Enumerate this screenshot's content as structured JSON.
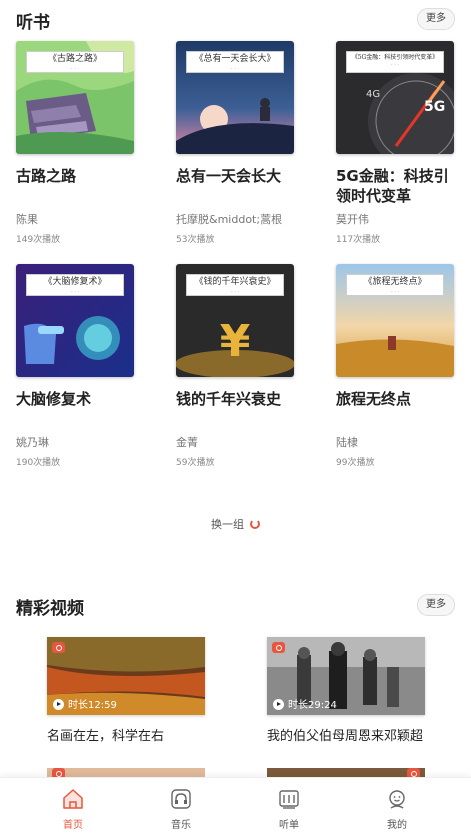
{
  "books_section": {
    "title": "听书",
    "more_label": "更多"
  },
  "books": [
    {
      "cover_title": "《古路之路》",
      "title": "古路之路",
      "author": "陈果",
      "plays": "149次播放"
    },
    {
      "cover_title": "《总有一天会长大》",
      "title": "总有一天会长大",
      "author": "托摩脱&middot;蒿根",
      "plays": "53次播放"
    },
    {
      "cover_title": "《5G金融：科技引领时代变革》",
      "title": "5G金融：科技引领时代变革",
      "author": "莫开伟",
      "plays": "117次播放"
    },
    {
      "cover_title": "《大脑修复术》",
      "title": "大脑修复术",
      "author": "姚乃琳",
      "plays": "190次播放"
    },
    {
      "cover_title": "《钱的千年兴衰史》",
      "title": "钱的千年兴衰史",
      "author": "金菁",
      "plays": "59次播放"
    },
    {
      "cover_title": "《旅程无终点》",
      "title": "旅程无终点",
      "author": "陆棣",
      "plays": "99次播放"
    }
  ],
  "refresh_label": "换一组",
  "videos_section": {
    "title": "精彩视频",
    "more_label": "更多"
  },
  "videos": [
    {
      "duration": "时长12:59",
      "title": "名画在左，科学在右"
    },
    {
      "duration": "时长29:24",
      "title": "我的伯父伯母周恩来邓颖超"
    }
  ],
  "tabs": [
    {
      "label": "首页",
      "icon": "home-icon",
      "active": true
    },
    {
      "label": "音乐",
      "icon": "headphones-icon",
      "active": false
    },
    {
      "label": "听单",
      "icon": "playlist-icon",
      "active": false
    },
    {
      "label": "我的",
      "icon": "profile-icon",
      "active": false
    }
  ],
  "colors": {
    "accent": "#e8563f",
    "text": "#222222",
    "muted": "#888888"
  }
}
